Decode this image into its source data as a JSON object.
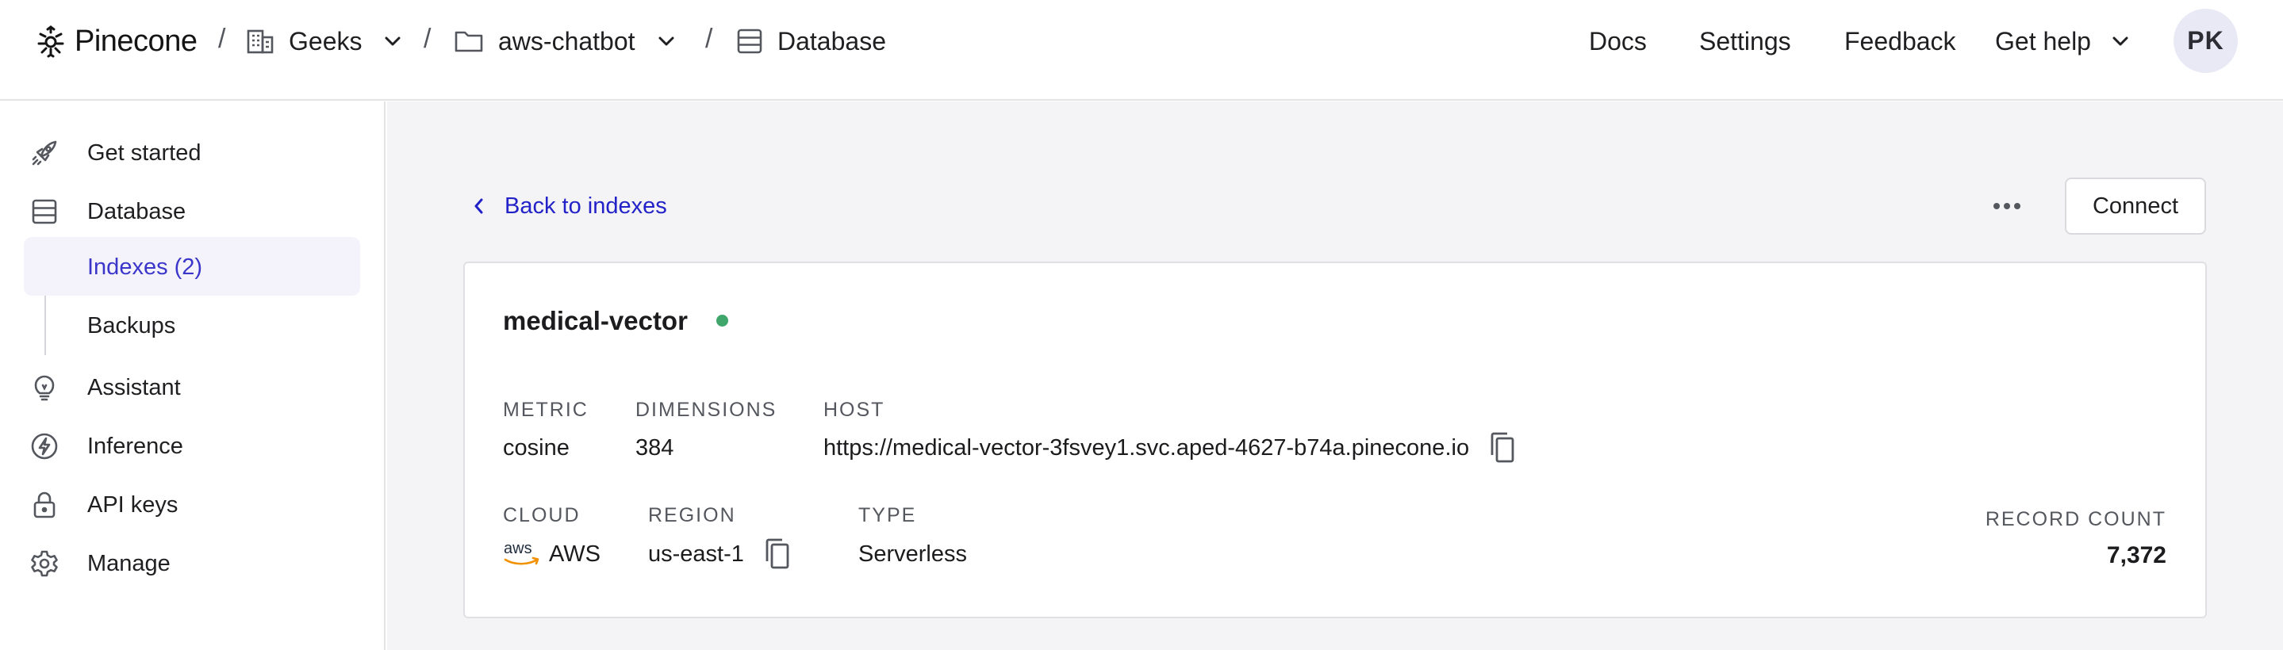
{
  "header": {
    "brand": "Pinecone",
    "breadcrumbs": [
      {
        "label": "Geeks",
        "icon": "building-icon"
      },
      {
        "label": "aws-chatbot",
        "icon": "folder-icon"
      },
      {
        "label": "Database",
        "icon": "database-icon"
      }
    ],
    "separator": "/",
    "nav": {
      "docs": "Docs",
      "settings": "Settings",
      "feedback": "Feedback",
      "get_help": "Get help"
    },
    "avatar_initials": "PK"
  },
  "sidebar": {
    "items": [
      {
        "label": "Get started",
        "icon": "rocket-icon"
      },
      {
        "label": "Database",
        "icon": "database-icon"
      },
      {
        "label": "Indexes (2)",
        "active": true
      },
      {
        "label": "Backups"
      },
      {
        "label": "Assistant",
        "icon": "lightbulb-icon"
      },
      {
        "label": "Inference",
        "icon": "bolt-icon"
      },
      {
        "label": "API keys",
        "icon": "lock-icon"
      },
      {
        "label": "Manage",
        "icon": "gear-icon"
      }
    ]
  },
  "main": {
    "back_label": "Back to indexes",
    "connect_label": "Connect",
    "index": {
      "name": "medical-vector",
      "status_color": "#3fa66b",
      "metric_label": "METRIC",
      "metric": "cosine",
      "dimensions_label": "DIMENSIONS",
      "dimensions": "384",
      "host_label": "HOST",
      "host": "https://medical-vector-3fsvey1.svc.aped-4627-b74a.pinecone.io",
      "cloud_label": "CLOUD",
      "cloud_logo": "aws",
      "cloud": "AWS",
      "region_label": "REGION",
      "region": "us-east-1",
      "type_label": "TYPE",
      "type": "Serverless",
      "record_count_label": "RECORD COUNT",
      "record_count": "7,372"
    }
  },
  "colors": {
    "accent": "#2222c8",
    "active_bg": "#f4f3fb",
    "active_text": "#3b36c9",
    "main_bg": "#f4f4f6"
  }
}
